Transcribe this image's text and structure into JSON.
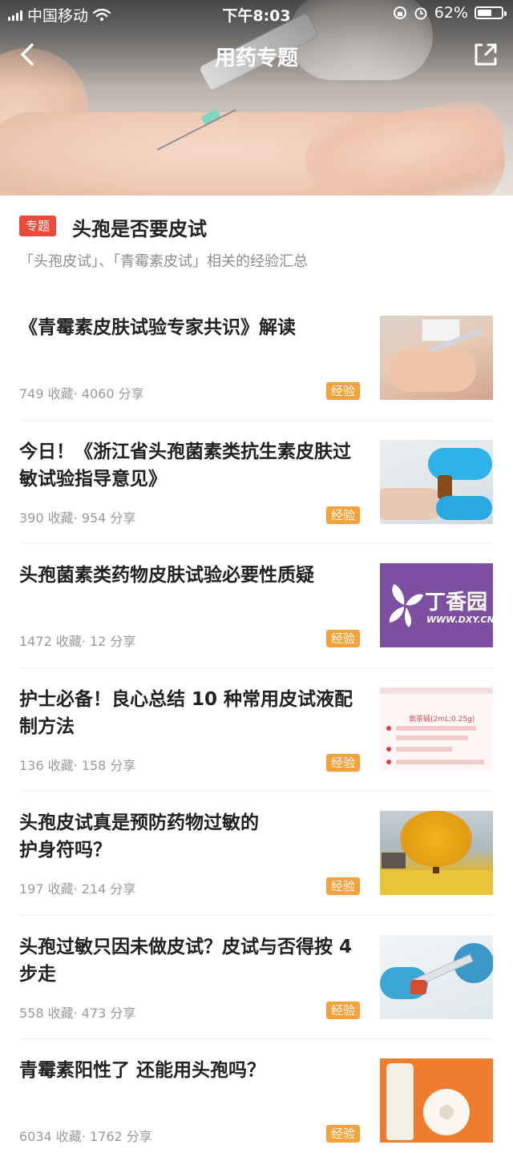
{
  "status_bar": {
    "carrier": "中国移动",
    "time": "下午8:03",
    "battery_percent": "62%",
    "battery_level": 0.62
  },
  "nav": {
    "title": "用药专题",
    "back_icon": "chevron-left-icon",
    "share_icon": "share-external-icon"
  },
  "topic": {
    "badge": "专题",
    "title": "头孢是否要皮试",
    "description": "「头孢皮试」、「青霉素皮试」相关的经验汇总"
  },
  "articles": [
    {
      "title": "《青霉素皮肤试验专家共识》解读",
      "meta": "749 收藏· 4060 分享",
      "tag": "经验"
    },
    {
      "title": "今日！《浙江省头孢菌素类抗生素皮肤过敏试验指导意见》",
      "meta": "390 收藏· 954 分享",
      "tag": "经验"
    },
    {
      "title": "头孢菌素类药物皮肤试验必要性质疑",
      "meta": "1472 收藏· 12 分享",
      "tag": "经验",
      "thumb_logo": "丁香园",
      "thumb_url": "WWW.DXY.CN"
    },
    {
      "title": "护士必备！良心总结 10 种常用皮试液配制方法",
      "meta": "136 收藏· 158 分享",
      "tag": "经验",
      "thumb_header": "氨茶碱(2mL:0.25g)"
    },
    {
      "title": "头孢皮试真是预防药物过敏的\n护身符吗？",
      "meta": "197 收藏· 214 分享",
      "tag": "经验"
    },
    {
      "title": "头孢过敏只因未做皮试？皮试与否得按 4 步走",
      "meta": "558 收藏· 473 分享",
      "tag": "经验"
    },
    {
      "title": "青霉素阳性了 还能用头孢吗？",
      "meta": "6034 收藏· 1762 分享",
      "tag": "经验"
    }
  ],
  "colors": {
    "topic_badge": "#ea4b3b",
    "tag": "#f6a13a",
    "meta_text": "#9a9a9a"
  }
}
